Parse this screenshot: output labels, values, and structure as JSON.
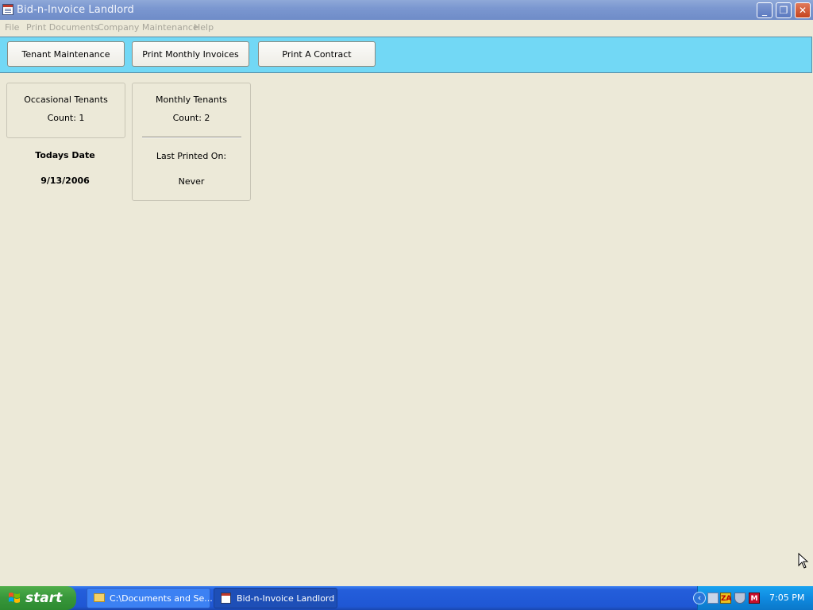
{
  "window": {
    "title": "Bid-n-Invoice Landlord",
    "controls": {
      "minimize": "_",
      "maximize": "❐",
      "close": "✕"
    }
  },
  "menu": {
    "items": [
      "File",
      "Print Documents",
      "Company Maintenance",
      "Help"
    ]
  },
  "toolbar": {
    "buttons": [
      "Tenant Maintenance",
      "Print Monthly Invoices",
      "Print A Contract"
    ]
  },
  "occasional": {
    "title": "Occasional Tenants",
    "count": "Count: 1"
  },
  "monthly": {
    "title": "Monthly Tenants",
    "count": "Count: 2",
    "last_printed_label": "Last Printed On:",
    "last_printed_value": "Never"
  },
  "today": {
    "label": "Todays Date",
    "value": "9/13/2006"
  },
  "taskbar": {
    "start_label": "start",
    "tasks": [
      "C:\\Documents and Se...",
      "Bid-n-Invoice Landlord"
    ],
    "tray_icons": [
      "network-icon",
      "zonealarm-icon",
      "security-shield-icon",
      "mcafee-icon"
    ],
    "tray_labels": {
      "zonealarm": "ZA",
      "mcafee": "M"
    },
    "clock": "7:05 PM"
  },
  "colors": {
    "titlebar": "#7b97d0",
    "toolbar_panel": "#72d8f5",
    "background": "#ece9d8",
    "taskbar": "#245edb",
    "start_button": "#37963a"
  }
}
